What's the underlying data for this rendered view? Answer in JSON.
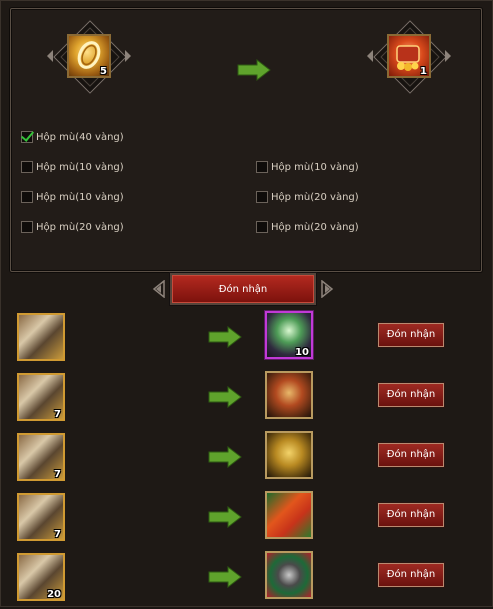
{
  "top": {
    "source_item": {
      "icon": "gold-bracelet-icon",
      "count": "5"
    },
    "result_item": {
      "icon": "treasure-chest-icon",
      "count": "1"
    },
    "options": [
      {
        "label": "Hộp mù(40 vàng)",
        "checked": true
      },
      {
        "label": "Hộp mù(10 vàng)",
        "checked": false
      },
      {
        "label": "Hộp mù(10 vàng)",
        "checked": false
      },
      {
        "label": "Hộp mù(10 vàng)",
        "checked": false
      },
      {
        "label": "Hộp mù(20 vàng)",
        "checked": false
      },
      {
        "label": "Hộp mù(20 vàng)",
        "checked": false
      },
      {
        "label": "Hộp mù(20 vàng)",
        "checked": false
      }
    ],
    "claim_label": "Đón nhận"
  },
  "rows": [
    {
      "source_icon": "armor-gauntlet-icon",
      "source_count": "",
      "reward_icon": "green-orb-helmet-icon",
      "reward_count": "10",
      "button": "Đón nhận"
    },
    {
      "source_icon": "armor-gauntlet-icon",
      "source_count": "7",
      "reward_icon": "red-armor-icon",
      "reward_count": "",
      "button": "Đón nhận"
    },
    {
      "source_icon": "armor-gauntlet-icon",
      "source_count": "7",
      "reward_icon": "golden-creature-icon",
      "reward_count": "",
      "button": "Đón nhận"
    },
    {
      "source_icon": "armor-gauntlet-icon",
      "source_count": "7",
      "reward_icon": "fire-dragon-icon",
      "reward_count": "",
      "button": "Đón nhận"
    },
    {
      "source_icon": "armor-gauntlet-icon",
      "source_count": "20",
      "reward_icon": "dark-mount-icon",
      "reward_count": "",
      "button": "Đón nhận"
    }
  ],
  "colors": {
    "accent_green": "#35c23a",
    "button_red": "#9e2a22",
    "frame_gold": "#d09a32"
  }
}
